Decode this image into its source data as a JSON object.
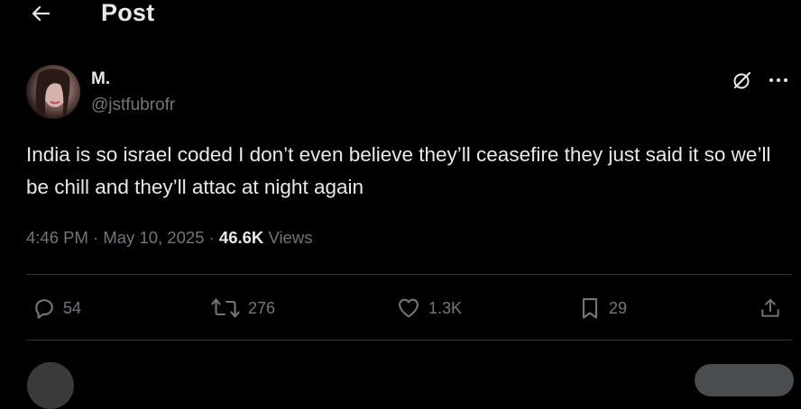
{
  "header": {
    "title": "Post"
  },
  "author": {
    "display_name": "M.",
    "handle": "@jstfubrofr"
  },
  "tweet": {
    "text": "India is so israel coded I don’t even believe they’ll ceasefire they just said it so we’ll be chill and they’ll attac at night again"
  },
  "meta": {
    "time": "4:46 PM",
    "separator": "·",
    "date": "May 10, 2025",
    "views_count": "46.6K",
    "views_label": "Views"
  },
  "actions": {
    "replies": "54",
    "reposts": "276",
    "likes": "1.3K",
    "bookmarks": "29"
  },
  "icons": {
    "back": "arrow-left-icon",
    "grok": "grok-icon",
    "more": "more-horizontal-icon",
    "reply": "reply-icon",
    "repost": "repost-icon",
    "like": "heart-icon",
    "bookmark": "bookmark-icon",
    "share": "share-icon"
  },
  "colors": {
    "background": "#000000",
    "text_primary": "#e7e9ea",
    "text_secondary": "#71767b",
    "divider": "#2f3336"
  }
}
